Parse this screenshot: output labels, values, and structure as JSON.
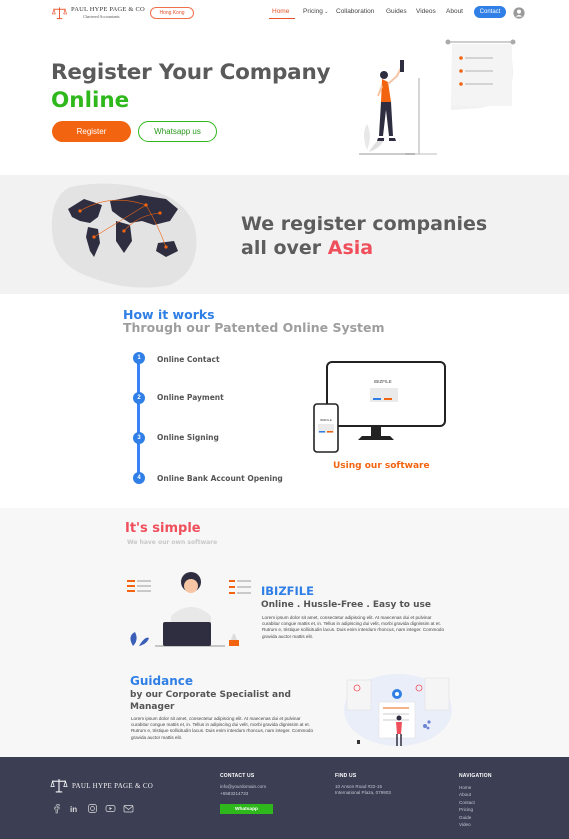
{
  "header": {
    "logo_name": "PAUL HYPE PAGE & CO",
    "logo_sub": "Chartered Accountants",
    "region": "Hong Kong",
    "nav": [
      {
        "label": "Home",
        "active": true
      },
      {
        "label": "Pricing"
      },
      {
        "label": "Collaboration"
      },
      {
        "label": "Guides"
      },
      {
        "label": "Videos"
      },
      {
        "label": "About"
      }
    ],
    "contact_label": "Contact"
  },
  "hero": {
    "title_line1": "Register Your Company",
    "title_line2": "Online",
    "register_label": "Register",
    "whatsapp_label": "Whatsapp us"
  },
  "asia": {
    "line1": "We register companies",
    "line2_prefix": "all over ",
    "line2_highlight": "Asia"
  },
  "how": {
    "title": "How it works",
    "subtitle": "Through our Patented Online System",
    "steps": [
      {
        "num": "1",
        "label": "Online Contact"
      },
      {
        "num": "2",
        "label": "Online Payment"
      },
      {
        "num": "3",
        "label": "Online Signing"
      },
      {
        "num": "4",
        "label": "Online Bank Account Opening"
      }
    ],
    "screen_label": "IBIZFILE",
    "phone_label": "IBIZFILE",
    "using_label": "Using our software"
  },
  "simple": {
    "title": "It's simple",
    "subtitle": "We have our own software",
    "ibiz_title": "IBIZFILE",
    "ibiz_tagline": "Online . Hussle-Free . Easy to use",
    "ibiz_text": "Lorem ipsum dolor sit amet, consectetur adipiscing elit. At maecenas dui et pulvinar curabitur congue mattis et, in. Tellus in adipiscing dui velit, morbi gravida dignissim at et. Rutrum e, tristique sollicitudin lacus. Duis enim interdum rhoncus, nam integer. Commodo gravida auctor mattis elit.",
    "guid_title": "Guidance",
    "guid_sub": "by our Corporate Specialist and Manager",
    "guid_text": "Lorem ipsum dolor sit amet, consectetur adipiscing elit. At maecenas dui et pulvinar curabitur congue mattis et, in. Tellus in adipiscing dui velit, morbi gravida dignissim at et. Rutrum e, tristique sollicitudin lacus. Duis enim interdum rhoncus, nam integer. Commodo gravida auctor mattis elit."
  },
  "footer": {
    "logo_name": "PAUL HYPE PAGE & CO",
    "contact_head": "CONTACT US",
    "email": "info@yourdomain.com",
    "phone": "+6583214733",
    "whatsapp_label": "Whatsapp",
    "find_head": "FIND US",
    "address1": "10 Anson Road #22-15",
    "address2": "International Plaza, 079903",
    "nav_head": "NAVIGATION",
    "nav": [
      "Home",
      "About",
      "Contact",
      "Pricing",
      "Guide",
      "Video"
    ]
  },
  "colors": {
    "orange": "#f26410",
    "green": "#2fb81c",
    "blue": "#2f7fe6",
    "red": "#ef4f5b",
    "footer_bg": "#3c3f54"
  }
}
